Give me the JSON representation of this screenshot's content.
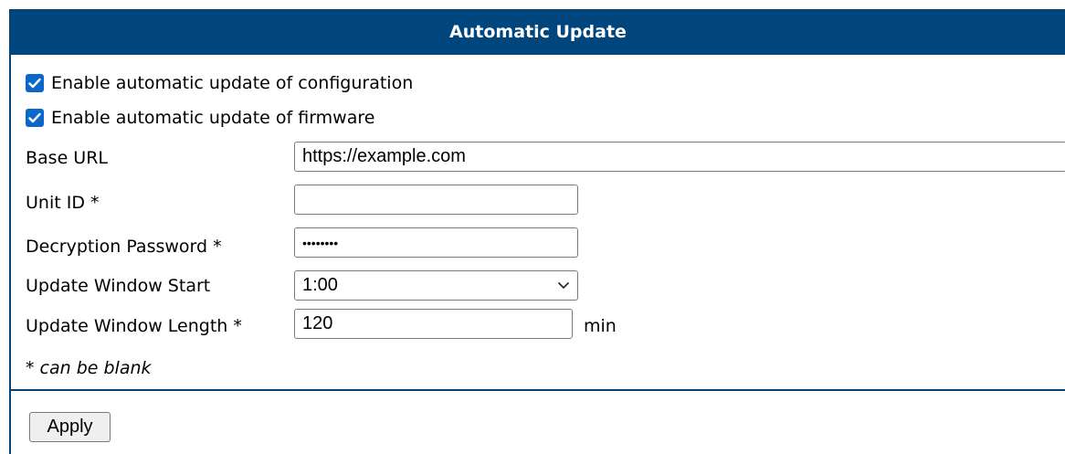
{
  "panel": {
    "title": "Automatic Update"
  },
  "options": {
    "config_label": "Enable automatic update of configuration",
    "config_checked": true,
    "firmware_label": "Enable automatic update of firmware",
    "firmware_checked": true
  },
  "fields": {
    "base_url": {
      "label": "Base URL",
      "value": "https://example.com"
    },
    "unit_id": {
      "label": "Unit ID *",
      "value": ""
    },
    "decryption_password": {
      "label": "Decryption Password *",
      "value": "••••••••"
    },
    "window_start": {
      "label": "Update Window Start",
      "value": "1:00"
    },
    "window_length": {
      "label": "Update Window Length *",
      "value": "120",
      "unit": "min"
    }
  },
  "note": "* can be blank",
  "actions": {
    "apply_label": "Apply"
  },
  "colors": {
    "header_bg": "#00457c",
    "checkbox": "#0b67c8"
  }
}
